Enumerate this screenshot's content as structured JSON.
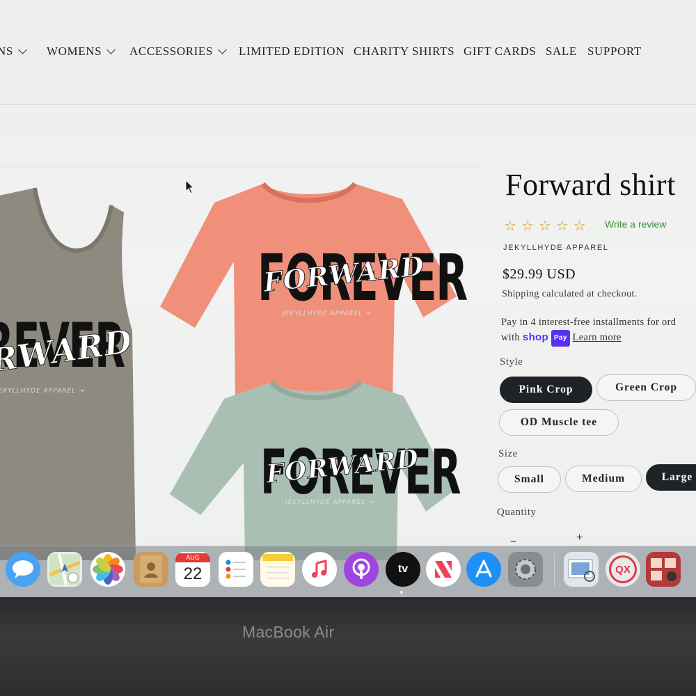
{
  "nav": {
    "items": [
      {
        "label": "NS",
        "has_dropdown": true
      },
      {
        "label": "WOMENS",
        "has_dropdown": true
      },
      {
        "label": "ACCESSORIES",
        "has_dropdown": true
      },
      {
        "label": "LIMITED EDITION",
        "has_dropdown": false
      },
      {
        "label": "CHARITY SHIRTS",
        "has_dropdown": false
      },
      {
        "label": "GIFT CARDS",
        "has_dropdown": false
      },
      {
        "label": "SALE",
        "has_dropdown": false
      },
      {
        "label": "SUPPORT",
        "has_dropdown": false
      }
    ]
  },
  "gallery": {
    "print_main": "FOREVER",
    "print_overlay": "FORWARD",
    "tank_lines": [
      "REVER",
      "RWARD"
    ],
    "print_sub": "JEKYLLHYDE APPAREL →"
  },
  "product": {
    "title": "Forward shirt",
    "rating_stars": 5,
    "rating_value": 0,
    "write_review": "Write a review",
    "vendor": "JEKYLLHYDE APPAREL",
    "price": "$29.99 USD",
    "shipping": "Shipping calculated at checkout.",
    "installments_line1": "Pay in 4 interest-free installments for ord",
    "installments_with": "with",
    "shop_word": "shop",
    "shop_pay": "Pay",
    "learn_more": "Learn more",
    "style_label": "Style",
    "styles": [
      {
        "label": "Pink Crop",
        "selected": true
      },
      {
        "label": "Green Crop",
        "selected": false
      },
      {
        "label": "OD Muscle tee",
        "selected": false
      }
    ],
    "size_label": "Size",
    "sizes": [
      {
        "label": "Small",
        "selected": false
      },
      {
        "label": "Medium",
        "selected": false
      },
      {
        "label": "Large",
        "selected": true
      }
    ],
    "quantity_label": "Quantity",
    "quantity_minus": "−",
    "quantity_plus": "+"
  },
  "dock": {
    "calendar_month": "AUG",
    "calendar_day": "22",
    "tv_label": "tv",
    "qx_label": "QX",
    "apps": [
      "messages-icon",
      "maps-icon",
      "photos-icon",
      "contacts-icon",
      "calendar-icon",
      "reminders-icon",
      "notes-icon",
      "music-icon",
      "podcasts-icon",
      "apple-tv-icon",
      "news-icon",
      "app-store-icon",
      "system-preferences-icon",
      "preview-icon",
      "quicktime-icon",
      "photo-booth-icon"
    ]
  },
  "device": {
    "brand": "MacBook Air"
  },
  "colors": {
    "selected_pill": "#1f2327",
    "review_link": "#3d8f3d",
    "star": "#c99a1a",
    "shop_pay": "#5a31f4",
    "pink_tee": "#f0907a",
    "green_tee": "#a9bfb4",
    "tank": "#8e8a80"
  }
}
